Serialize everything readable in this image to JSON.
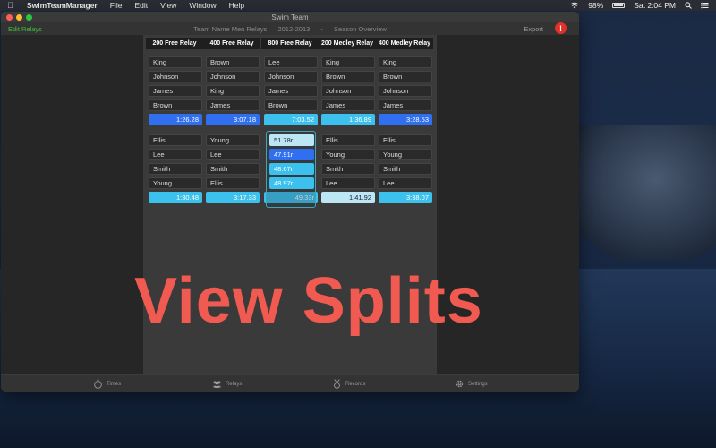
{
  "menubar": {
    "app_name": "SwimTeamManager",
    "menus": [
      "File",
      "Edit",
      "View",
      "Window",
      "Help"
    ],
    "battery": "98%",
    "battery_level": 0.98,
    "clock": "Sat 2:04 PM"
  },
  "window": {
    "title": "Swim Team",
    "toolbar": {
      "edit_relays": "Edit Relays",
      "team": "Team Name Men Relays",
      "season": "2012-2013",
      "separator": "-",
      "view": "Season Overview",
      "export": "Export",
      "alert": "!"
    }
  },
  "relays": {
    "columns": [
      "200 Free Relay",
      "400 Free Relay",
      "800 Free Relay",
      "200 Medley Relay",
      "400 Medley Relay"
    ],
    "team_a": {
      "swimmers": [
        [
          "King",
          "Brown",
          "Lee",
          "King",
          "King"
        ],
        [
          "Johnson",
          "Johnson",
          "Johnson",
          "Brown",
          "Brown"
        ],
        [
          "James",
          "King",
          "James",
          "Johnson",
          "Johnson"
        ],
        [
          "Brown",
          "James",
          "Brown",
          "James",
          "James"
        ]
      ],
      "times": [
        "1:26.28",
        "3:07.18",
        "7:03.52",
        "1:36.89",
        "3:28.53"
      ]
    },
    "team_b": {
      "swimmers": [
        [
          "Ellis",
          "Young",
          "",
          "Ellis",
          "Ellis"
        ],
        [
          "Lee",
          "Lee",
          "",
          "Young",
          "Young"
        ],
        [
          "Smith",
          "Smith",
          "",
          "Smith",
          "Smith"
        ],
        [
          "Young",
          "Ellis",
          "",
          "Lee",
          "Lee"
        ]
      ],
      "times": [
        "1:30.48",
        "3:17.33",
        "49.33r",
        "1:41.92",
        "3:38.07"
      ]
    },
    "splits": [
      "51.78r",
      "47.91r",
      "48.67r",
      "48.97r"
    ]
  },
  "overlay_text": "View Splits",
  "tabs": [
    "Times",
    "Relays",
    "Records",
    "Settings"
  ],
  "colors": {
    "accent_green": "#3fbf3f",
    "time_blue": "#2f6ff0",
    "time_cyan": "#3cc0ee",
    "time_light": "#bde6f5",
    "overlay_red": "#f05a50",
    "alert_red": "#e0302a"
  }
}
